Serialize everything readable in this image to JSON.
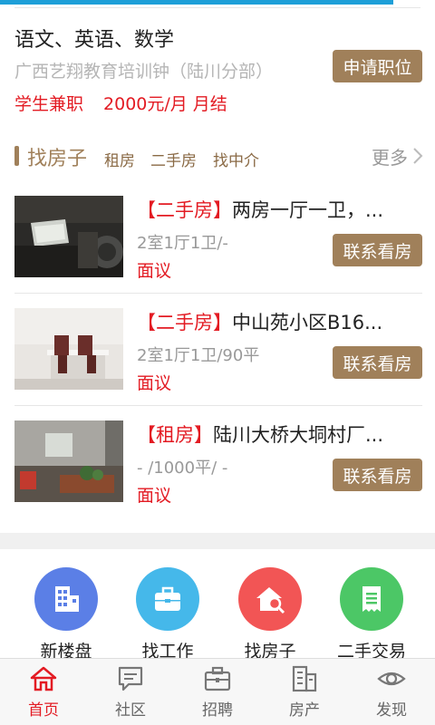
{
  "job": {
    "title": "语文、英语、数学",
    "company": "广西艺翔教育培训钟（陆川分部）",
    "apply_label": "申请职位",
    "type": "学生兼职",
    "salary": "2000元/月 月结"
  },
  "housing": {
    "title": "找房子",
    "tabs": [
      "租房",
      "二手房",
      "找中介"
    ],
    "more_label": "更多"
  },
  "listings": [
    {
      "tag": "【二手房】",
      "title": "两房一厅一卫，...",
      "spec": "2室1厅1卫/-",
      "price": "面议",
      "button": "联系看房"
    },
    {
      "tag": "【二手房】",
      "title": "中山苑小区B16...",
      "spec": "2室1厅1卫/90平",
      "price": "面议",
      "button": "联系看房"
    },
    {
      "tag": "【租房】",
      "title": "陆川大桥大垌村厂...",
      "spec": "- /1000平/ -",
      "price": "面议",
      "button": "联系看房"
    }
  ],
  "quick_links": [
    {
      "label": "新楼盘",
      "icon": "building-icon",
      "color": "#5b7fe6"
    },
    {
      "label": "找工作",
      "icon": "briefcase-icon",
      "color": "#45b8ea"
    },
    {
      "label": "找房子",
      "icon": "house-search-icon",
      "color": "#f25555"
    },
    {
      "label": "二手交易",
      "icon": "receipt-icon",
      "color": "#4cc766"
    }
  ],
  "tabs": [
    {
      "label": "首页",
      "icon": "home-icon",
      "active": true
    },
    {
      "label": "社区",
      "icon": "chat-icon",
      "active": false
    },
    {
      "label": "招聘",
      "icon": "briefcase-icon",
      "active": false
    },
    {
      "label": "房产",
      "icon": "buildings-icon",
      "active": false
    },
    {
      "label": "发现",
      "icon": "eye-icon",
      "active": false
    }
  ],
  "colors": {
    "brand_brown": "#a0805a",
    "price_red": "#e31b23",
    "accent_blue": "#1e9fd8"
  }
}
